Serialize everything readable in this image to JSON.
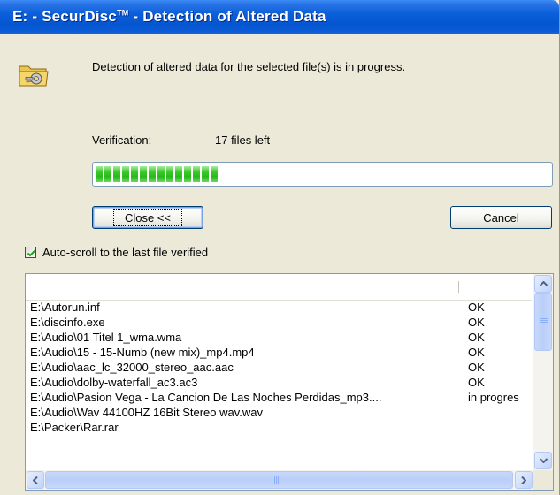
{
  "window": {
    "title_prefix": "E: - SecurDisc",
    "title_tm": "TM",
    "title_suffix": " - Detection of Altered Data"
  },
  "message": "Detection of altered data for the selected file(s) is in progress.",
  "verification": {
    "label": "Verification:",
    "count_text": "17 files left",
    "progress_fraction": 0.28
  },
  "buttons": {
    "close_label": "Close <<",
    "cancel_label": "Cancel"
  },
  "autoscroll": {
    "label": "Auto-scroll to the last file verified",
    "checked": true
  },
  "file_list": {
    "rows": [
      {
        "file": "E:\\Autorun.inf",
        "status": "OK"
      },
      {
        "file": "E:\\discinfo.exe",
        "status": "OK"
      },
      {
        "file": "E:\\Audio\\01 Titel 1_wma.wma",
        "status": "OK"
      },
      {
        "file": "E:\\Audio\\15 - 15-Numb (new mix)_mp4.mp4",
        "status": "OK"
      },
      {
        "file": "E:\\Audio\\aac_lc_32000_stereo_aac.aac",
        "status": "OK"
      },
      {
        "file": "E:\\Audio\\dolby-waterfall_ac3.ac3",
        "status": "OK"
      },
      {
        "file": "E:\\Audio\\Pasion Vega - La Cancion De Las Noches Perdidas_mp3....",
        "status": "in progres"
      },
      {
        "file": "E:\\Audio\\Wav 44100HZ 16Bit Stereo wav.wav",
        "status": ""
      },
      {
        "file": "E:\\Packer\\Rar.rar",
        "status": ""
      }
    ]
  },
  "colors": {
    "titlebar": "#0A5FDA",
    "progress_green": "#27B91A",
    "dialog_bg": "#ECE9D8"
  },
  "icons": {
    "app": "securdisc-folder-key-icon",
    "checkbox": "checkmark-icon",
    "scroll_up": "scroll-up-arrow-icon",
    "scroll_down": "scroll-down-arrow-icon",
    "scroll_left": "scroll-left-arrow-icon",
    "scroll_right": "scroll-right-arrow-icon"
  }
}
